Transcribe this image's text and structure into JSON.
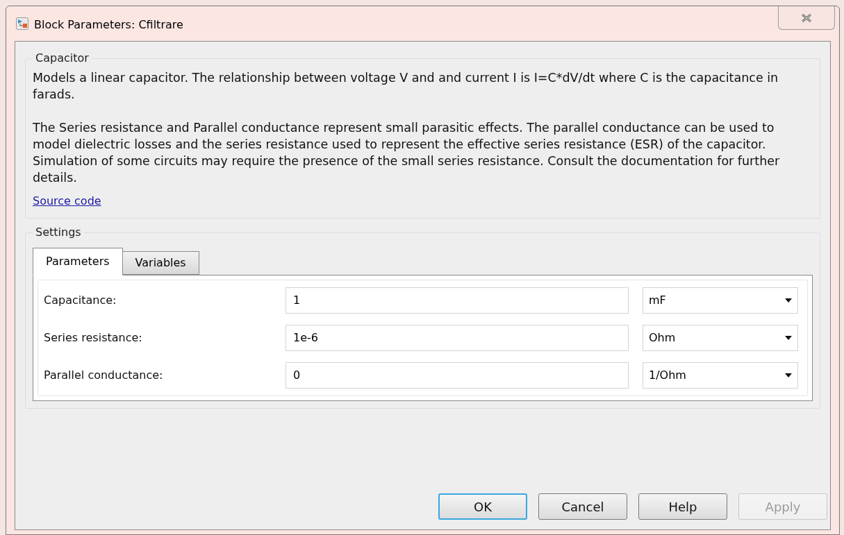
{
  "window": {
    "title": "Block Parameters: Cfiltrare"
  },
  "description": {
    "title": "Capacitor",
    "paragraphs": [
      "Models a linear capacitor. The relationship between voltage V and and current I is I=C*dV/dt where C is the capacitance in farads.",
      "The Series resistance and Parallel conductance represent small parasitic effects. The parallel conductance can be used to model dielectric losses and the series resistance used to represent the effective series resistance (ESR) of the capacitor. Simulation of some circuits may require the presence of the small series resistance. Consult the documentation for further details."
    ],
    "link": "Source code"
  },
  "settings": {
    "title": "Settings",
    "tabs": [
      {
        "label": "Parameters",
        "selected": true
      },
      {
        "label": "Variables",
        "selected": false
      }
    ],
    "parameters": [
      {
        "label": "Capacitance:",
        "value": "1",
        "unit": "mF"
      },
      {
        "label": "Series resistance:",
        "value": "1e-6",
        "unit": "Ohm"
      },
      {
        "label": "Parallel conductance:",
        "value": "0",
        "unit": "1/Ohm"
      }
    ]
  },
  "buttons": [
    {
      "label": "OK",
      "default": true,
      "disabled": false
    },
    {
      "label": "Cancel",
      "default": false,
      "disabled": false
    },
    {
      "label": "Help",
      "default": false,
      "disabled": false
    },
    {
      "label": "Apply",
      "default": false,
      "disabled": true
    }
  ]
}
